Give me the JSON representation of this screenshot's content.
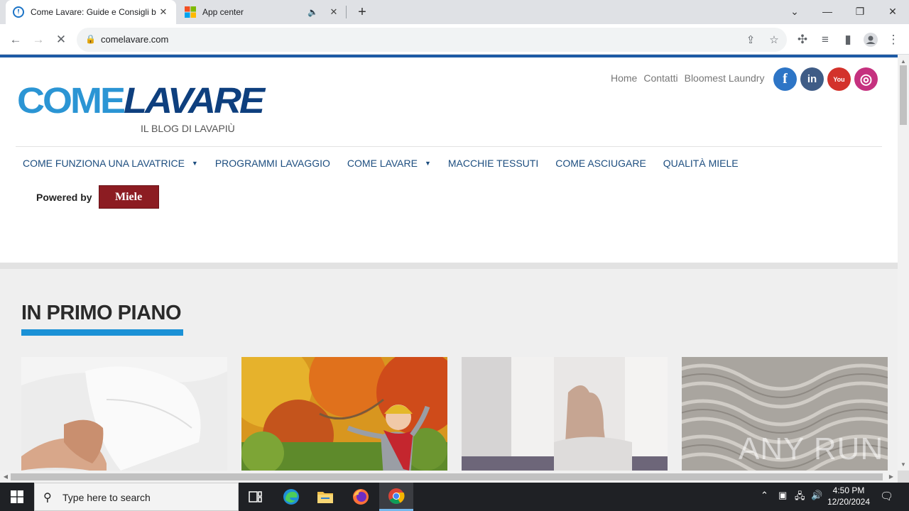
{
  "browser": {
    "tabs": [
      {
        "title": "Come Lavare: Guide e Consigli b",
        "active": true
      },
      {
        "title": "App center",
        "active": false
      }
    ],
    "url": "comelavare.com"
  },
  "site": {
    "logo": {
      "part1": "COME",
      "part2": "LAVARE",
      "tagline": "IL BLOG DI LAVAPIÙ"
    },
    "top_links": [
      "Home",
      "Contatti",
      "Bloomest Laundry"
    ],
    "social": [
      {
        "name": "facebook",
        "glyph": "f",
        "color": "#2d75c6"
      },
      {
        "name": "linkedin",
        "glyph": "in",
        "color": "#3f5c86"
      },
      {
        "name": "youtube",
        "glyph": "You",
        "color": "#d3322b"
      },
      {
        "name": "instagram",
        "glyph": "◎",
        "color": "#c5317f"
      }
    ],
    "nav": [
      {
        "label": "COME FUNZIONA UNA LAVATRICE",
        "has_dropdown": true
      },
      {
        "label": "PROGRAMMI LAVAGGIO",
        "has_dropdown": false
      },
      {
        "label": "COME LAVARE",
        "has_dropdown": true
      },
      {
        "label": "MACCHIE TESSUTI",
        "has_dropdown": false
      },
      {
        "label": "COME ASCIUGARE",
        "has_dropdown": false
      },
      {
        "label": "QUALITÀ MIELE",
        "has_dropdown": false
      }
    ],
    "powered_by": {
      "label": "Powered by",
      "brand": "Miele"
    },
    "section_title": "IN PRIMO PIANO",
    "cards": [
      {
        "image": "duvet-pillows-photo"
      },
      {
        "image": "child-autumn-leaves-photo"
      },
      {
        "image": "iron-blur-photo"
      },
      {
        "image": "wool-knit-photo"
      }
    ],
    "watermark": "ANY RUN"
  },
  "taskbar": {
    "search_placeholder": "Type here to search",
    "time": "4:50 PM",
    "date": "12/20/2024"
  }
}
